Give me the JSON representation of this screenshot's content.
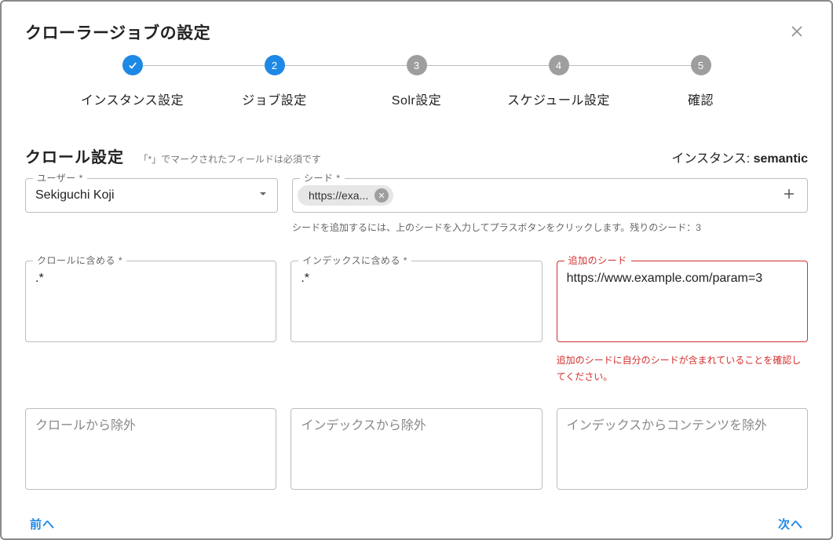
{
  "dialog": {
    "title": "クローラージョブの設定"
  },
  "stepper": {
    "steps": [
      {
        "label": "インスタンス設定",
        "state": "done"
      },
      {
        "label": "ジョブ設定",
        "state": "active",
        "num": "2"
      },
      {
        "label": "Solr設定",
        "state": "pending",
        "num": "3"
      },
      {
        "label": "スケジュール設定",
        "state": "pending",
        "num": "4"
      },
      {
        "label": "確認",
        "state": "pending",
        "num": "5"
      }
    ]
  },
  "section": {
    "title": "クロール設定",
    "hint": "「*」でマークされたフィールドは必須です",
    "instance_prefix": "インスタンス: ",
    "instance_name": "semantic"
  },
  "fields": {
    "user": {
      "label": "ユーザー *",
      "value": "Sekiguchi Koji"
    },
    "seed": {
      "label": "シード *",
      "chip_text": "https://exa...",
      "helper": "シードを追加するには、上のシードを入力してプラスボタンをクリックします。残りのシード：3"
    },
    "include_crawl": {
      "label": "クロールに含める *",
      "value": ".*"
    },
    "include_index": {
      "label": "インデックスに含める *",
      "value": ".*"
    },
    "extra_seed": {
      "label": "追加のシード",
      "value": "https://www.example.com/param=3",
      "error": "追加のシードに自分のシードが含まれていることを確認してください。"
    },
    "exclude_crawl": {
      "placeholder": "クロールから除外"
    },
    "exclude_index": {
      "placeholder": "インデックスから除外"
    },
    "exclude_content": {
      "placeholder": "インデックスからコンテンツを除外"
    }
  },
  "footer": {
    "prev": "前へ",
    "next": "次へ"
  }
}
